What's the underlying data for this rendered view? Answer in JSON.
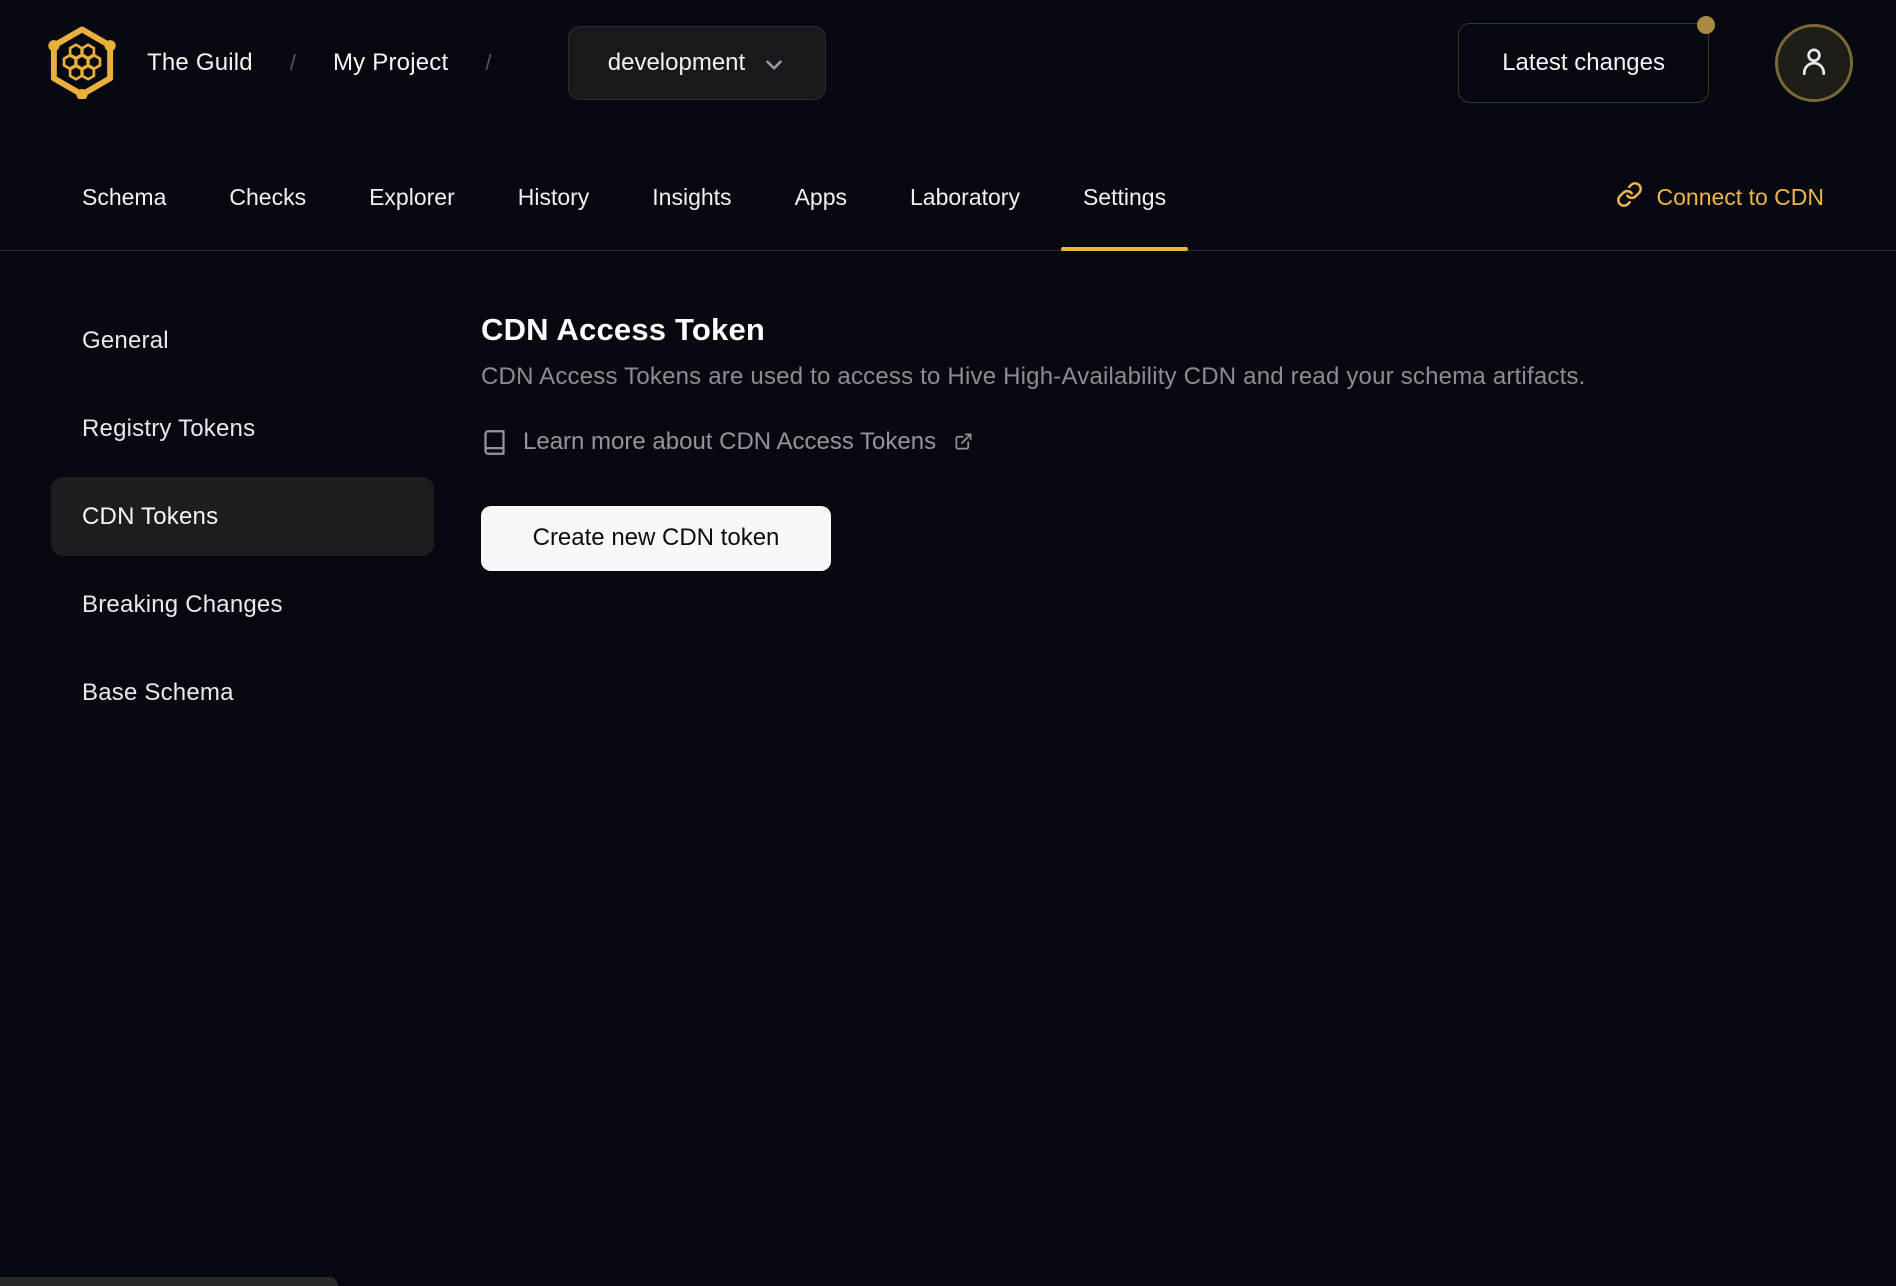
{
  "header": {
    "org": "The Guild",
    "separator": "/",
    "project": "My Project",
    "target_selector": {
      "value": "development"
    },
    "latest_changes_label": "Latest changes"
  },
  "tabs": {
    "items": [
      {
        "label": "Schema",
        "active": false
      },
      {
        "label": "Checks",
        "active": false
      },
      {
        "label": "Explorer",
        "active": false
      },
      {
        "label": "History",
        "active": false
      },
      {
        "label": "Insights",
        "active": false
      },
      {
        "label": "Apps",
        "active": false
      },
      {
        "label": "Laboratory",
        "active": false
      },
      {
        "label": "Settings",
        "active": true
      }
    ],
    "connect_cdn_label": "Connect to CDN"
  },
  "sidebar": {
    "items": [
      {
        "label": "General",
        "active": false
      },
      {
        "label": "Registry Tokens",
        "active": false
      },
      {
        "label": "CDN Tokens",
        "active": true
      },
      {
        "label": "Breaking Changes",
        "active": false
      },
      {
        "label": "Base Schema",
        "active": false
      }
    ]
  },
  "main": {
    "title": "CDN Access Token",
    "description": "CDN Access Tokens are used to access to Hive High-Availability CDN and read your schema artifacts.",
    "learn_more_label": "Learn more about CDN Access Tokens",
    "create_button_label": "Create new CDN token"
  },
  "icons": {
    "logo": "hive-honeycomb-logo",
    "chevron": "chevron-down-icon",
    "user": "user-icon",
    "link": "chain-link-icon",
    "book": "book-icon",
    "external": "external-link-icon",
    "notification_dot": "unread-dot"
  },
  "colors": {
    "background": "#060910",
    "accent_gold": "#e9b13c",
    "tab_underline": "#f0b13d",
    "connect_link": "#f0b54a",
    "notification_dot": "#a98a41",
    "avatar_ring": "#7b6836",
    "muted_text": "#8c8d92",
    "active_item_bg": "#1c1d1f",
    "create_button_bg": "#f7f8fa"
  }
}
